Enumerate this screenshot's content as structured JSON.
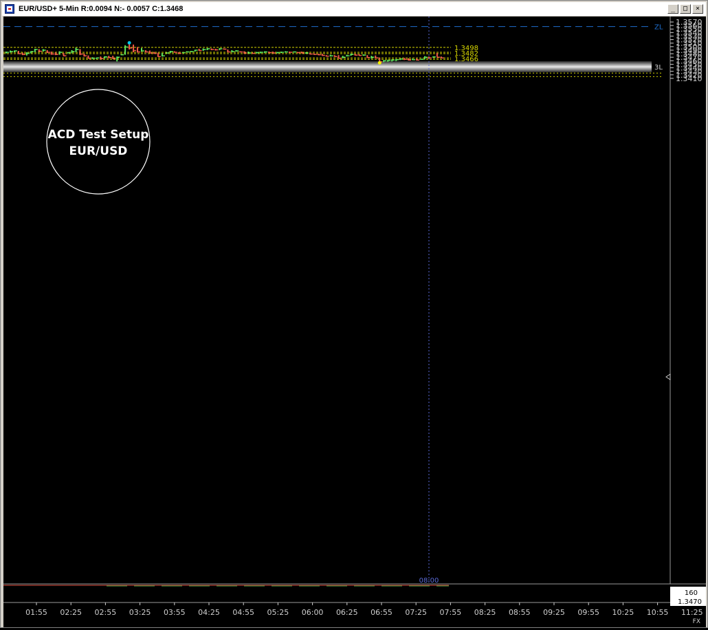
{
  "window": {
    "title": "EUR/USD+ 5-Min R:0.0094 N:- 0.0057 C:1.3468",
    "buttons": [
      {
        "name": "minimize-button",
        "glyph": "_"
      },
      {
        "name": "maximize-button",
        "glyph": "□"
      },
      {
        "name": "close-button",
        "glyph": "×"
      }
    ]
  },
  "annotation": {
    "line1": "ACD Test Setup",
    "line2": "EUR/USD"
  },
  "price_axis": {
    "labels": [
      "1.3570",
      "1.3560",
      "1.3550",
      "1.3540",
      "1.3530",
      "1.3520",
      "1.3510",
      "1.3500",
      "1.3490",
      "1.3480",
      "1.3470",
      "1.3460",
      "1.3450",
      "1.3440",
      "1.3430",
      "1.3420",
      "1.3410"
    ]
  },
  "time_axis": {
    "labels": [
      "01:55",
      "02:25",
      "02:55",
      "03:25",
      "03:55",
      "04:25",
      "04:55",
      "05:25",
      "06:00",
      "06:25",
      "06:55",
      "07:25",
      "07:55",
      "08:25",
      "08:55",
      "09:25",
      "09:55",
      "10:25",
      "10:55",
      "11:25"
    ]
  },
  "cursor": {
    "time_label": "08:00"
  },
  "footer": {
    "volume": "160",
    "price": "1.3470",
    "tag": "FX"
  },
  "chart_data": {
    "type": "ohlc",
    "instrument": "EUR/USD+",
    "interval": "5-Min",
    "ylim": [
      1.341,
      1.3572
    ],
    "levels": [
      {
        "label": "ZL",
        "price": 1.3557,
        "style": "dashed",
        "color": "#1e6fd0"
      },
      {
        "label": "1.3498",
        "price": 1.3498,
        "style": "dashed",
        "color": "#d8d800"
      },
      {
        "label": "1.3482",
        "price": 1.3482,
        "style": "double-dashed",
        "color": "#d8d800"
      },
      {
        "label": "1.3466",
        "price": 1.3466,
        "style": "double-dashed",
        "color": "#d8d800"
      },
      {
        "label": "1.3450",
        "price": 1.345,
        "style": "dashed",
        "color": "#d8d800"
      },
      {
        "label": "3L",
        "price": 1.3443,
        "style": "thick-band",
        "color": "#9a9a9a"
      }
    ],
    "extra_dotted_lines": [
      1.3425,
      1.3415
    ],
    "bar_colors": {
      "up": "#5ee65e",
      "down": "#f05a4a"
    },
    "bars": [
      {
        "h": 1.3486,
        "l": 1.3481,
        "c": 1.3484
      },
      {
        "h": 1.3489,
        "l": 1.3483,
        "c": 1.3486
      },
      {
        "h": 1.3489,
        "l": 1.3484,
        "c": 1.3488
      },
      {
        "h": 1.3488,
        "l": 1.3479,
        "c": 1.348
      },
      {
        "h": 1.3483,
        "l": 1.3476,
        "c": 1.3478
      },
      {
        "h": 1.3484,
        "l": 1.3475,
        "c": 1.3481
      },
      {
        "h": 1.3487,
        "l": 1.3481,
        "c": 1.3486
      },
      {
        "h": 1.3494,
        "l": 1.3484,
        "c": 1.3492
      },
      {
        "h": 1.3493,
        "l": 1.3485,
        "c": 1.3487
      },
      {
        "h": 1.3493,
        "l": 1.3486,
        "c": 1.349
      },
      {
        "h": 1.349,
        "l": 1.3482,
        "c": 1.3484
      },
      {
        "h": 1.3486,
        "l": 1.3477,
        "c": 1.3479
      },
      {
        "h": 1.3484,
        "l": 1.3476,
        "c": 1.3478
      },
      {
        "h": 1.3487,
        "l": 1.3477,
        "c": 1.3484
      },
      {
        "h": 1.3482,
        "l": 1.3473,
        "c": 1.3474
      },
      {
        "h": 1.3484,
        "l": 1.3481,
        "c": 1.3483
      },
      {
        "h": 1.349,
        "l": 1.3481,
        "c": 1.3486
      },
      {
        "h": 1.3497,
        "l": 1.3484,
        "c": 1.3492
      },
      {
        "h": 1.3493,
        "l": 1.3476,
        "c": 1.3479
      },
      {
        "h": 1.348,
        "l": 1.3472,
        "c": 1.3474
      },
      {
        "h": 1.3475,
        "l": 1.3466,
        "c": 1.3467
      },
      {
        "h": 1.347,
        "l": 1.3465,
        "c": 1.3467
      },
      {
        "h": 1.3469,
        "l": 1.3465,
        "c": 1.3468
      },
      {
        "h": 1.3472,
        "l": 1.3464,
        "c": 1.3466
      },
      {
        "h": 1.3473,
        "l": 1.3466,
        "c": 1.3471
      },
      {
        "h": 1.3474,
        "l": 1.3467,
        "c": 1.3469
      },
      {
        "h": 1.3474,
        "l": 1.3465,
        "c": 1.3466
      },
      {
        "h": 1.3472,
        "l": 1.3458,
        "c": 1.347
      },
      {
        "h": 1.3478,
        "l": 1.3476,
        "c": 1.3477
      },
      {
        "h": 1.3504,
        "l": 1.3477,
        "c": 1.3499
      },
      {
        "h": 1.351,
        "l": 1.3492,
        "c": 1.3496
      },
      {
        "h": 1.3506,
        "l": 1.3484,
        "c": 1.3489
      },
      {
        "h": 1.3499,
        "l": 1.3483,
        "c": 1.3485
      },
      {
        "h": 1.3496,
        "l": 1.3486,
        "c": 1.3488
      },
      {
        "h": 1.349,
        "l": 1.3483,
        "c": 1.3485
      },
      {
        "h": 1.3489,
        "l": 1.3481,
        "c": 1.3482
      },
      {
        "h": 1.3485,
        "l": 1.348,
        "c": 1.3481
      },
      {
        "h": 1.3483,
        "l": 1.3471,
        "c": 1.3472
      },
      {
        "h": 1.3482,
        "l": 1.3472,
        "c": 1.3474
      },
      {
        "h": 1.3483,
        "l": 1.3481,
        "c": 1.3482
      },
      {
        "h": 1.3488,
        "l": 1.3482,
        "c": 1.3486
      },
      {
        "h": 1.3487,
        "l": 1.3483,
        "c": 1.3484
      },
      {
        "h": 1.3484,
        "l": 1.3479,
        "c": 1.3481
      },
      {
        "h": 1.3484,
        "l": 1.3482,
        "c": 1.3483
      },
      {
        "h": 1.3487,
        "l": 1.3484,
        "c": 1.3485
      },
      {
        "h": 1.3488,
        "l": 1.3485,
        "c": 1.3486
      },
      {
        "h": 1.3491,
        "l": 1.3486,
        "c": 1.349
      },
      {
        "h": 1.3494,
        "l": 1.3488,
        "c": 1.3489
      },
      {
        "h": 1.3495,
        "l": 1.3488,
        "c": 1.3492
      },
      {
        "h": 1.3496,
        "l": 1.349,
        "c": 1.3494
      },
      {
        "h": 1.3495,
        "l": 1.349,
        "c": 1.3492
      },
      {
        "h": 1.3494,
        "l": 1.3489,
        "c": 1.3491
      },
      {
        "h": 1.3496,
        "l": 1.349,
        "c": 1.3494
      },
      {
        "h": 1.3495,
        "l": 1.3492,
        "c": 1.3493
      },
      {
        "h": 1.3492,
        "l": 1.3484,
        "c": 1.3485
      },
      {
        "h": 1.349,
        "l": 1.3484,
        "c": 1.3486
      },
      {
        "h": 1.349,
        "l": 1.3486,
        "c": 1.3488
      },
      {
        "h": 1.3487,
        "l": 1.3484,
        "c": 1.3485
      },
      {
        "h": 1.3487,
        "l": 1.348,
        "c": 1.3482
      },
      {
        "h": 1.3486,
        "l": 1.3481,
        "c": 1.3482
      },
      {
        "h": 1.3483,
        "l": 1.348,
        "c": 1.3481
      },
      {
        "h": 1.3485,
        "l": 1.3481,
        "c": 1.3483
      },
      {
        "h": 1.3486,
        "l": 1.3481,
        "c": 1.3484
      },
      {
        "h": 1.3487,
        "l": 1.3482,
        "c": 1.3485
      },
      {
        "h": 1.3486,
        "l": 1.3482,
        "c": 1.3483
      },
      {
        "h": 1.3486,
        "l": 1.3481,
        "c": 1.3482
      },
      {
        "h": 1.3485,
        "l": 1.3481,
        "c": 1.3483
      },
      {
        "h": 1.3486,
        "l": 1.3482,
        "c": 1.3484
      },
      {
        "h": 1.3487,
        "l": 1.3483,
        "c": 1.3485
      },
      {
        "h": 1.3486,
        "l": 1.3482,
        "c": 1.3484
      },
      {
        "h": 1.3486,
        "l": 1.3483,
        "c": 1.3485
      },
      {
        "h": 1.3485,
        "l": 1.3482,
        "c": 1.3483
      },
      {
        "h": 1.3486,
        "l": 1.3481,
        "c": 1.3482
      },
      {
        "h": 1.3484,
        "l": 1.348,
        "c": 1.3482
      },
      {
        "h": 1.3482,
        "l": 1.3478,
        "c": 1.3479
      },
      {
        "h": 1.3481,
        "l": 1.3477,
        "c": 1.3478
      },
      {
        "h": 1.348,
        "l": 1.3476,
        "c": 1.3477
      },
      {
        "h": 1.348,
        "l": 1.3474,
        "c": 1.3475
      },
      {
        "h": 1.3476,
        "l": 1.3472,
        "c": 1.3473
      },
      {
        "h": 1.3477,
        "l": 1.3472,
        "c": 1.3474
      },
      {
        "h": 1.3476,
        "l": 1.3471,
        "c": 1.3472
      },
      {
        "h": 1.3476,
        "l": 1.3466,
        "c": 1.3467
      },
      {
        "h": 1.3474,
        "l": 1.3467,
        "c": 1.347
      },
      {
        "h": 1.3477,
        "l": 1.3472,
        "c": 1.3474
      },
      {
        "h": 1.348,
        "l": 1.3474,
        "c": 1.3478
      },
      {
        "h": 1.348,
        "l": 1.3475,
        "c": 1.3476
      },
      {
        "h": 1.3479,
        "l": 1.3474,
        "c": 1.3475
      },
      {
        "h": 1.3478,
        "l": 1.3474,
        "c": 1.3476
      },
      {
        "h": 1.3476,
        "l": 1.3468,
        "c": 1.3469
      },
      {
        "h": 1.3474,
        "l": 1.3466,
        "c": 1.347
      },
      {
        "h": 1.3475,
        "l": 1.3467,
        "c": 1.3468
      },
      {
        "h": 1.3469,
        "l": 1.3455,
        "c": 1.3457
      },
      {
        "h": 1.3462,
        "l": 1.3456,
        "c": 1.346
      },
      {
        "h": 1.3463,
        "l": 1.3457,
        "c": 1.3461
      },
      {
        "h": 1.3464,
        "l": 1.3458,
        "c": 1.3462
      },
      {
        "h": 1.3465,
        "l": 1.3459,
        "c": 1.3463
      },
      {
        "h": 1.3466,
        "l": 1.3462,
        "c": 1.3465
      },
      {
        "h": 1.3468,
        "l": 1.3462,
        "c": 1.3464
      },
      {
        "h": 1.3467,
        "l": 1.3461,
        "c": 1.3462
      },
      {
        "h": 1.3466,
        "l": 1.3462,
        "c": 1.3463
      },
      {
        "h": 1.3466,
        "l": 1.3461,
        "c": 1.3462
      },
      {
        "h": 1.3465,
        "l": 1.3463,
        "c": 1.3464
      },
      {
        "h": 1.3473,
        "l": 1.3464,
        "c": 1.347
      },
      {
        "h": 1.3472,
        "l": 1.3466,
        "c": 1.3468
      },
      {
        "h": 1.3472,
        "l": 1.3469,
        "c": 1.3471
      },
      {
        "h": 1.3482,
        "l": 1.3471,
        "c": 1.347
      },
      {
        "h": 1.3472,
        "l": 1.3467,
        "c": 1.3468
      }
    ],
    "markers": [
      {
        "bar": 30,
        "price": 1.3511,
        "color": "#00c8e8"
      },
      {
        "bar": 91,
        "price": 1.3454,
        "color": "#f0f000"
      }
    ]
  }
}
